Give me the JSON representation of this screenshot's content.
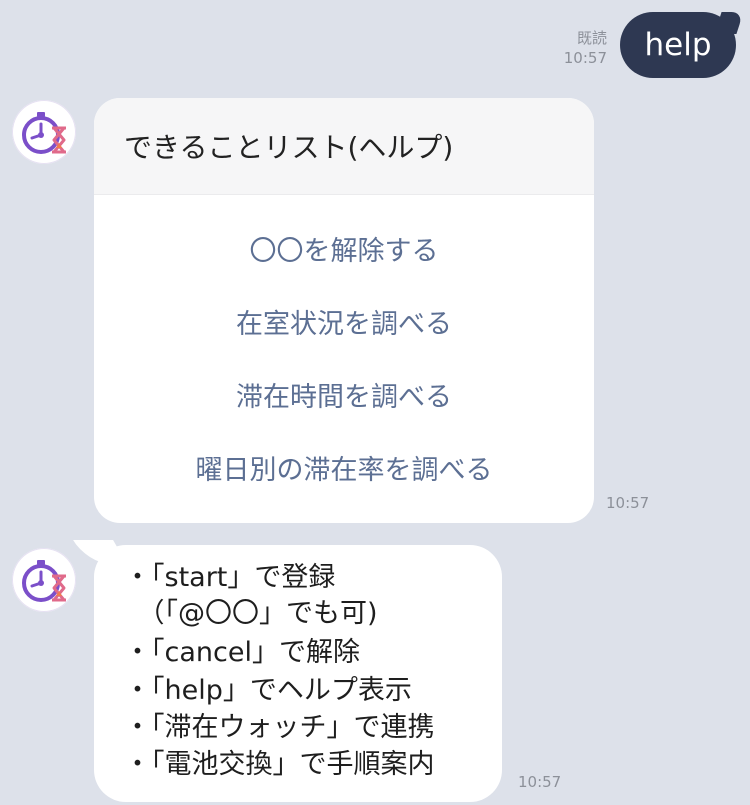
{
  "outgoing": {
    "read_label": "既読",
    "time": "10:57",
    "text": "help"
  },
  "card": {
    "title": "できることリスト(ヘルプ)",
    "actions": [
      "〇〇を解除する",
      "在室状況を調べる",
      "滞在時間を調べる",
      "曜日別の滞在率を調べる"
    ],
    "time": "10:57"
  },
  "message": {
    "lines": [
      "・「start」で登録",
      "　（「@〇〇」でも可)",
      "・「cancel」で解除",
      "・「help」でヘルプ表示",
      "・「滞在ウォッチ」で連携",
      "・「電池交換」で手順案内"
    ],
    "time": "10:57"
  },
  "colors": {
    "background": "#dde1ea",
    "outgoing_bubble": "#2e3852",
    "action_link": "#5c6f93"
  },
  "icons": {
    "bot_avatar": "stopwatch-hourglass-icon"
  }
}
